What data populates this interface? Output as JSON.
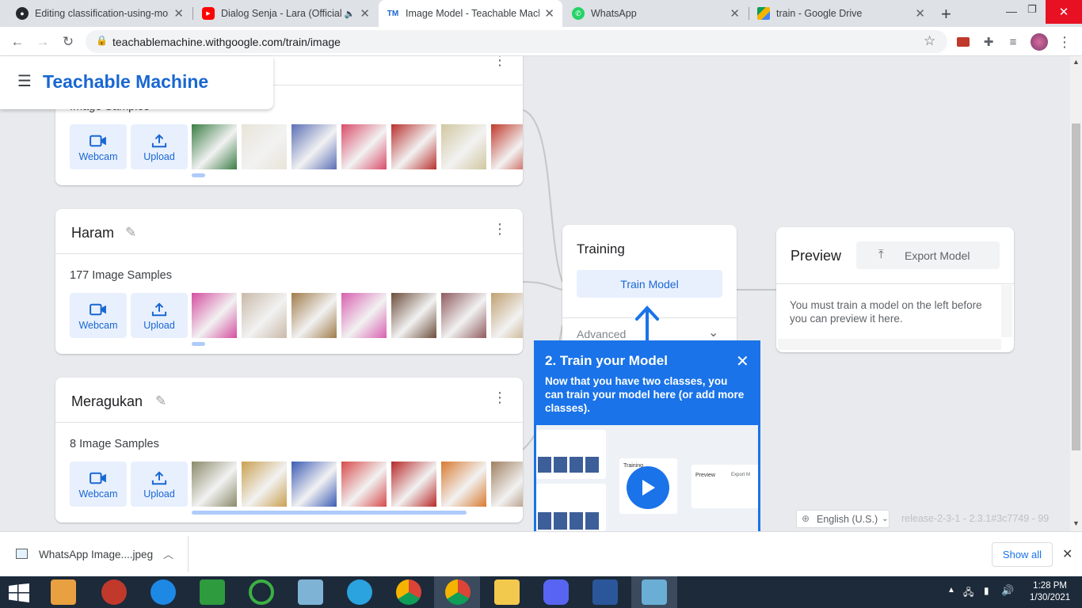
{
  "browser": {
    "tabs": [
      {
        "title": "Editing classification-using-mob",
        "icon": "github-icon"
      },
      {
        "title": "Dialog Senja - Lara (Official",
        "icon": "youtube-icon"
      },
      {
        "title": "Image Model - Teachable Mach",
        "icon": "teachable-machine-icon",
        "active": true
      },
      {
        "title": "WhatsApp",
        "icon": "whatsapp-icon"
      },
      {
        "title": "train - Google Drive",
        "icon": "google-drive-icon"
      }
    ],
    "url": "teachablemachine.withgoogle.com/train/image",
    "new_tab": "+"
  },
  "app": {
    "title": "Teachable Machine"
  },
  "classes": [
    {
      "name": "",
      "samples_label": "Image Samples",
      "webcam_label": "Webcam",
      "upload_label": "Upload",
      "thumb_colors": [
        "#3a7d44",
        "#e8e4d8",
        "#5b6fb5",
        "#d94c6a",
        "#b8312f",
        "#d1c7a0",
        "#c0392b"
      ]
    },
    {
      "name": "Haram",
      "samples_label": "177 Image Samples",
      "webcam_label": "Webcam",
      "upload_label": "Upload",
      "thumb_colors": [
        "#d44ea0",
        "#c9b9a8",
        "#a07c4a",
        "#d85fb0",
        "#6b4c3a",
        "#8f5a5e",
        "#c0a070"
      ]
    },
    {
      "name": "Meragukan",
      "samples_label": "8 Image Samples",
      "webcam_label": "Webcam",
      "upload_label": "Upload",
      "thumb_colors": [
        "#8a8a6a",
        "#c9a050",
        "#3b5bb5",
        "#d84a4a",
        "#b82828",
        "#d87a30",
        "#a08060"
      ]
    }
  ],
  "training": {
    "title": "Training",
    "button": "Train Model",
    "advanced": "Advanced"
  },
  "preview": {
    "title": "Preview",
    "export_button": "Export Model",
    "message": "You must train a model on the left before you can preview it here."
  },
  "tutorial": {
    "title": "2. Train your Model",
    "body": "Now that you have two classes, you can train your model here (or add more classes).",
    "video_training": "Training",
    "video_preview": "Preview",
    "video_export": "Export M"
  },
  "footer": {
    "language": "English (U.S.)",
    "release": "release-2-3-1 - 2.3.1#3c7749 - 99"
  },
  "downloads": {
    "file": "WhatsApp Image....jpeg",
    "show_all": "Show all"
  },
  "taskbar": {
    "time": "1:28 PM",
    "date": "1/30/2021"
  },
  "colors": {
    "accent": "#1a73e8",
    "brand_text": "#1967d2",
    "button_bg": "#e8f0fe"
  }
}
